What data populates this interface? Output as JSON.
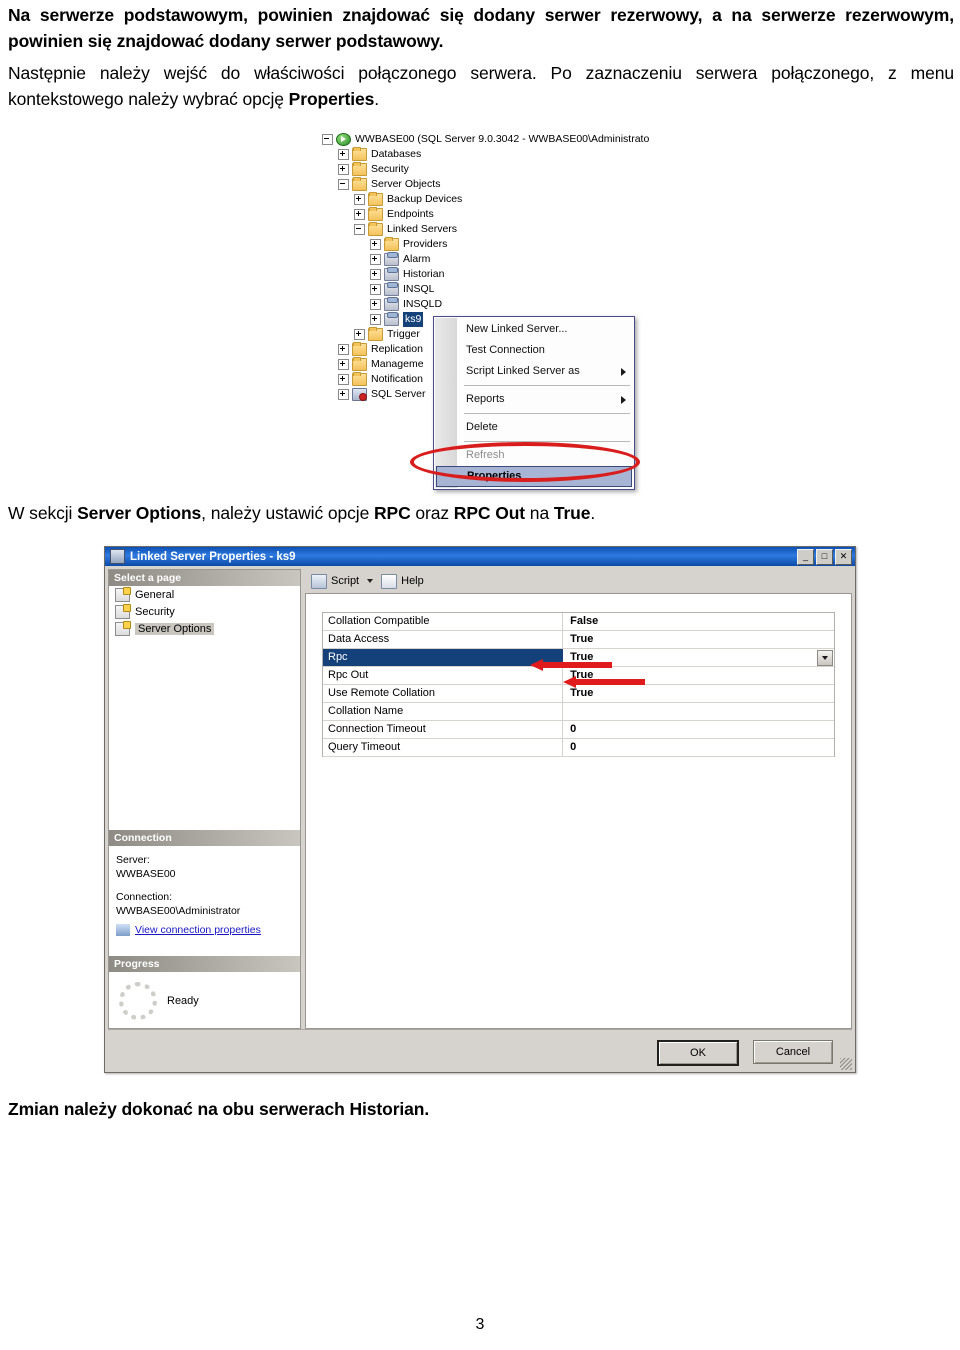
{
  "document": {
    "intro_paragraph": "Na serwerze podstawowym, powinien znajdować się dodany serwer rezerwowy, a na serwerze rezerwowym, powinien się znajdować dodany serwer podstawowy.",
    "next_paragraph_part1": "Następnie należy wejść do właściwości połączonego serwera. Po zaznaczeniu serwera połączonego, z menu kontekstowego należy wybrać opcję ",
    "next_paragraph_bold": "Properties",
    "next_paragraph_end": ".",
    "section_part1": "W sekcji ",
    "section_bold1": "Server Options",
    "section_part2": ", należy ustawić opcje ",
    "section_bold2": "RPC",
    "section_part3": " oraz ",
    "section_bold3": "RPC Out",
    "section_part4": " na ",
    "section_bold4": "True",
    "section_part5": ".",
    "footer_paragraph": "Zmian należy dokonać na obu serwerach Historian.",
    "page_number": "3"
  },
  "tree": {
    "nodes": [
      {
        "label": "WWBASE00 (SQL Server 9.0.3042 - WWBASE00\\Administrato",
        "indent": 0,
        "expander": "minus",
        "icon": "db-server-icon",
        "selected": false
      },
      {
        "label": "Databases",
        "indent": 1,
        "expander": "plus",
        "icon": "folder-icon",
        "selected": false
      },
      {
        "label": "Security",
        "indent": 1,
        "expander": "plus",
        "icon": "folder-icon",
        "selected": false
      },
      {
        "label": "Server Objects",
        "indent": 1,
        "expander": "minus",
        "icon": "folder-icon",
        "selected": false
      },
      {
        "label": "Backup Devices",
        "indent": 2,
        "expander": "plus",
        "icon": "folder-icon",
        "selected": false
      },
      {
        "label": "Endpoints",
        "indent": 2,
        "expander": "plus",
        "icon": "folder-icon",
        "selected": false
      },
      {
        "label": "Linked Servers",
        "indent": 2,
        "expander": "minus",
        "icon": "folder-icon",
        "selected": false
      },
      {
        "label": "Providers",
        "indent": 3,
        "expander": "plus",
        "icon": "folder-icon",
        "selected": false
      },
      {
        "label": "Alarm",
        "indent": 3,
        "expander": "plus",
        "icon": "linked-server-icon",
        "selected": false
      },
      {
        "label": "Historian",
        "indent": 3,
        "expander": "plus",
        "icon": "linked-server-icon",
        "selected": false
      },
      {
        "label": "INSQL",
        "indent": 3,
        "expander": "plus",
        "icon": "linked-server-icon",
        "selected": false
      },
      {
        "label": "INSQLD",
        "indent": 3,
        "expander": "plus",
        "icon": "linked-server-icon",
        "selected": false
      },
      {
        "label": "ks9",
        "indent": 3,
        "expander": "plus",
        "icon": "linked-server-icon",
        "selected": true
      },
      {
        "label": "Trigger",
        "indent": 2,
        "expander": "plus",
        "icon": "folder-icon",
        "selected": false
      },
      {
        "label": "Replication",
        "indent": 1,
        "expander": "plus",
        "icon": "folder-icon",
        "selected": false
      },
      {
        "label": "Manageme",
        "indent": 1,
        "expander": "plus",
        "icon": "folder-icon",
        "selected": false
      },
      {
        "label": "Notification",
        "indent": 1,
        "expander": "plus",
        "icon": "folder-icon",
        "selected": false
      },
      {
        "label": "SQL Server",
        "indent": 1,
        "expander": "plus",
        "icon": "sql-agent-icon",
        "selected": false
      }
    ]
  },
  "context_menu": {
    "items": [
      {
        "label": "New Linked Server...",
        "accel": "N",
        "submenu": false,
        "state": "normal"
      },
      {
        "label": "Test Connection",
        "accel": "T",
        "submenu": false,
        "state": "normal"
      },
      {
        "label": "Script Linked Server as",
        "accel": "S",
        "submenu": true,
        "state": "normal"
      },
      {
        "label": "Reports",
        "accel": "",
        "submenu": true,
        "state": "normal"
      },
      {
        "label": "Delete",
        "accel": "D",
        "submenu": false,
        "state": "normal"
      },
      {
        "label": "Refresh",
        "accel": "f",
        "submenu": false,
        "state": "dim"
      },
      {
        "label": "Properties",
        "accel": "r",
        "submenu": false,
        "state": "highlighted"
      }
    ],
    "annotation_color": "#d91d1d"
  },
  "dialog": {
    "title": "Linked Server Properties - ks9",
    "title_buttons": {
      "minimize": "_",
      "maximize": "□",
      "close": "✕"
    },
    "toolbar": {
      "script_label": "Script",
      "help_label": "Help"
    },
    "left_pane": {
      "select_page_header": "Select a page",
      "pages": [
        "General",
        "Security",
        "Server Options"
      ],
      "active_page": "Server Options",
      "connection_header": "Connection",
      "server_label": "Server:",
      "server_value": "WWBASE00",
      "connection_label": "Connection:",
      "connection_value": "WWBASE00\\Administrator",
      "view_connection_link": "View connection properties",
      "progress_header": "Progress",
      "progress_status": "Ready"
    },
    "properties": [
      {
        "name": "Collation Compatible",
        "value": "False",
        "selected": false
      },
      {
        "name": "Data Access",
        "value": "True",
        "selected": false
      },
      {
        "name": "Rpc",
        "value": "True",
        "selected": true
      },
      {
        "name": "Rpc Out",
        "value": "True",
        "selected": false
      },
      {
        "name": "Use Remote Collation",
        "value": "True",
        "selected": false
      },
      {
        "name": "Collation Name",
        "value": "",
        "selected": false
      },
      {
        "name": "Connection Timeout",
        "value": "0",
        "selected": false
      },
      {
        "name": "Query Timeout",
        "value": "0",
        "selected": false
      }
    ],
    "buttons": {
      "ok": "OK",
      "cancel": "Cancel"
    },
    "accent_selection_color": "#14417a",
    "annotation_arrow_color": "#e01b1b"
  }
}
